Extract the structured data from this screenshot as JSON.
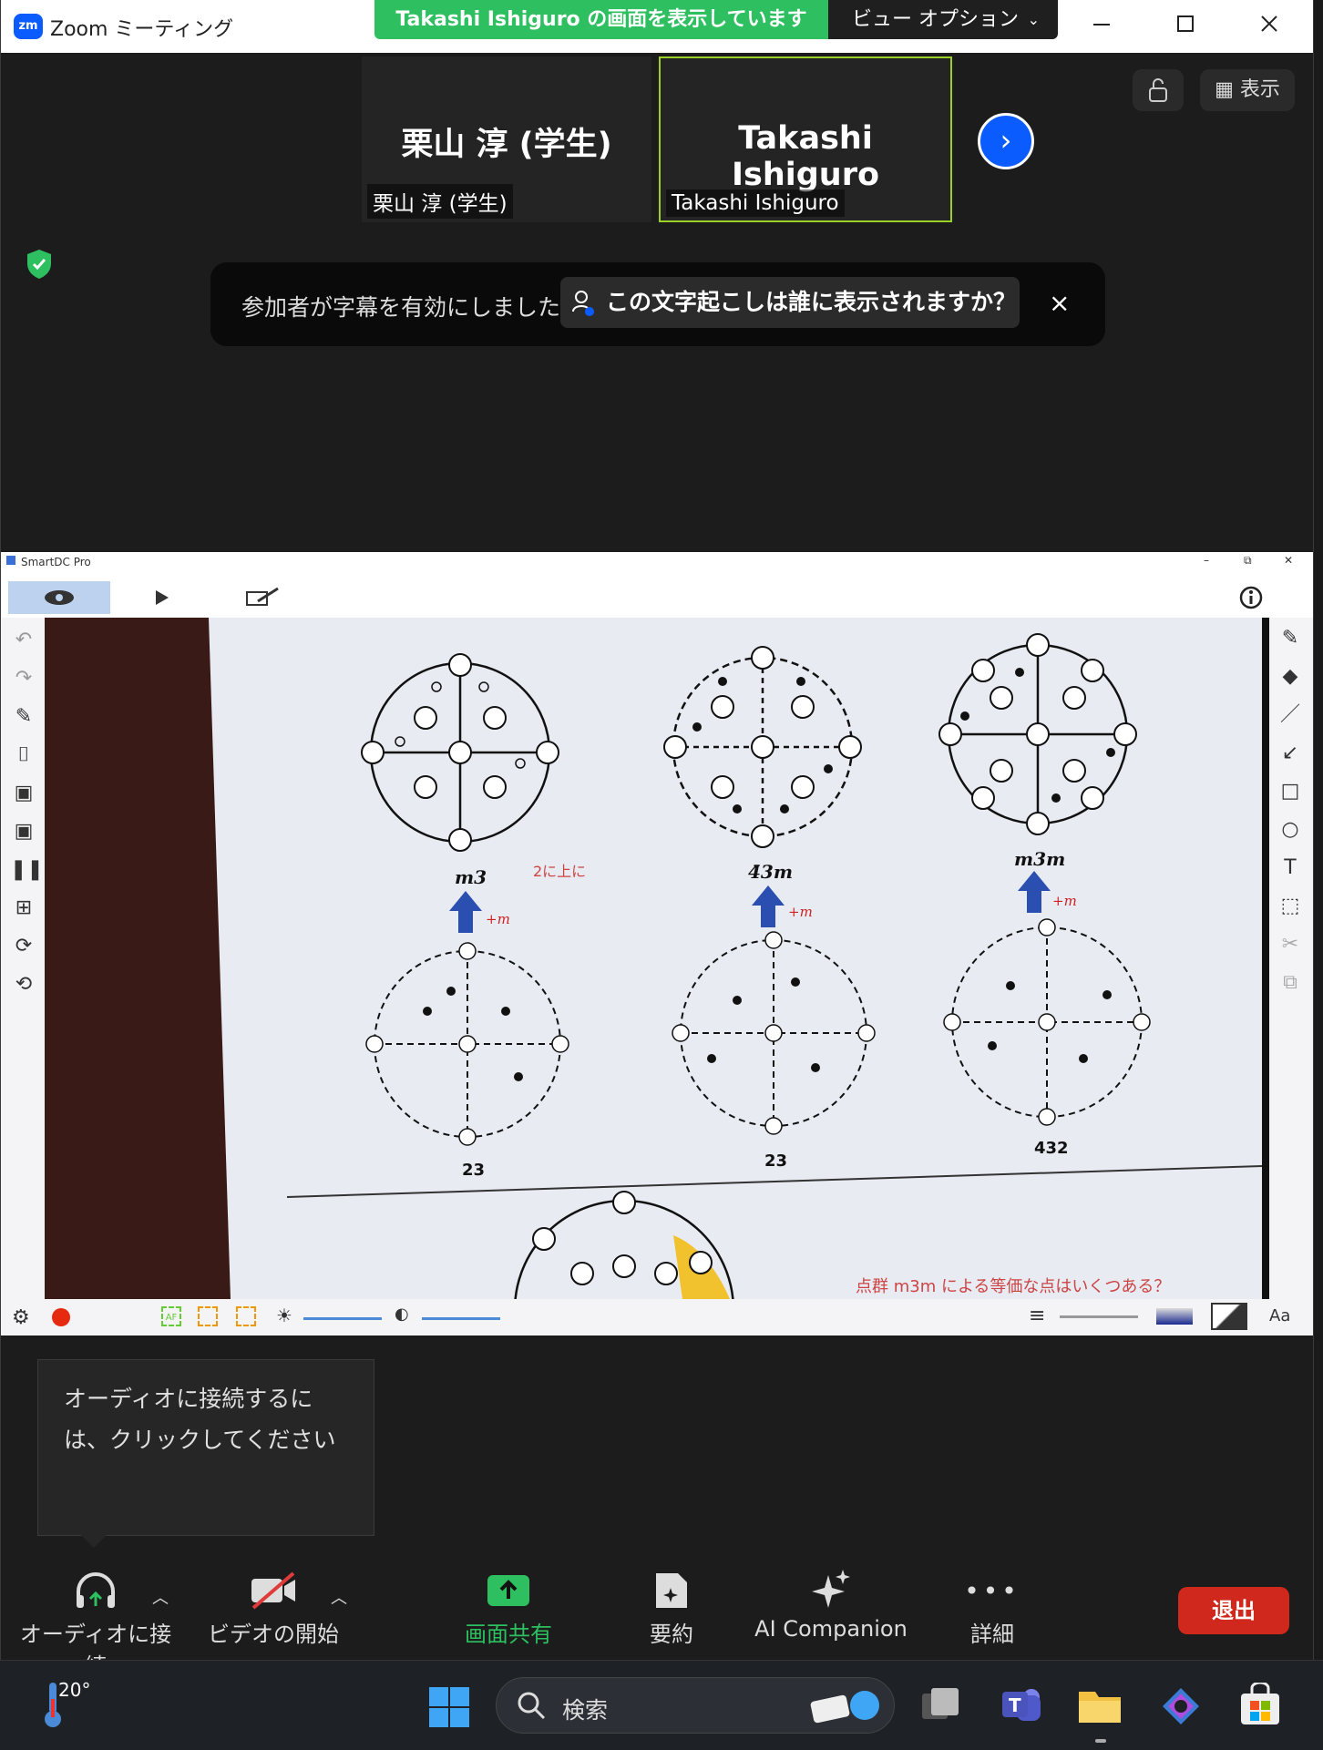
{
  "window": {
    "app_logo": "zm",
    "title": "Zoom ミーティング"
  },
  "share_banner": {
    "text": "Takashi Ishiguro の画面を表示しています"
  },
  "view_options": {
    "label": "ビュー オプション"
  },
  "participants": [
    {
      "big_name": "栗山 淳 (学生)",
      "label": "栗山 淳 (学生)"
    },
    {
      "big_name": "Takashi Ishiguro",
      "label": "Takashi Ishiguro"
    }
  ],
  "top_right": {
    "view_label": "表示"
  },
  "caption": {
    "message": "参加者が字幕を有効にしました",
    "question": "この文字起こしは誰に表示されますか？",
    "close": "×"
  },
  "shared": {
    "app_title": "SmartDC Pro",
    "figure": {
      "top_labels": [
        "m3",
        "4̄3m",
        "m3m"
      ],
      "arrow_labels": [
        "+m",
        "+m",
        "+m"
      ],
      "annotation": "2に上に",
      "bottom_labels": [
        "23",
        "23",
        "432"
      ],
      "bottom_text": "点群 m3m による等価な点はいくつある？"
    },
    "bottom_right_label": "Aa"
  },
  "audio_tooltip": {
    "text": "オーディオに接続するには、クリックしてください"
  },
  "toolbar": {
    "audio": "オーディオに接続",
    "video": "ビデオの開始",
    "share": "画面共有",
    "summary": "要約",
    "ai": "AI Companion",
    "more": "詳細",
    "leave": "退出"
  },
  "taskbar": {
    "temperature": "20°",
    "search_placeholder": "検索"
  },
  "colors": {
    "share_green": "#2dbf60",
    "zoom_blue": "#0b5cff",
    "leave_red": "#d0281c",
    "active_tile": "#9bd126"
  }
}
